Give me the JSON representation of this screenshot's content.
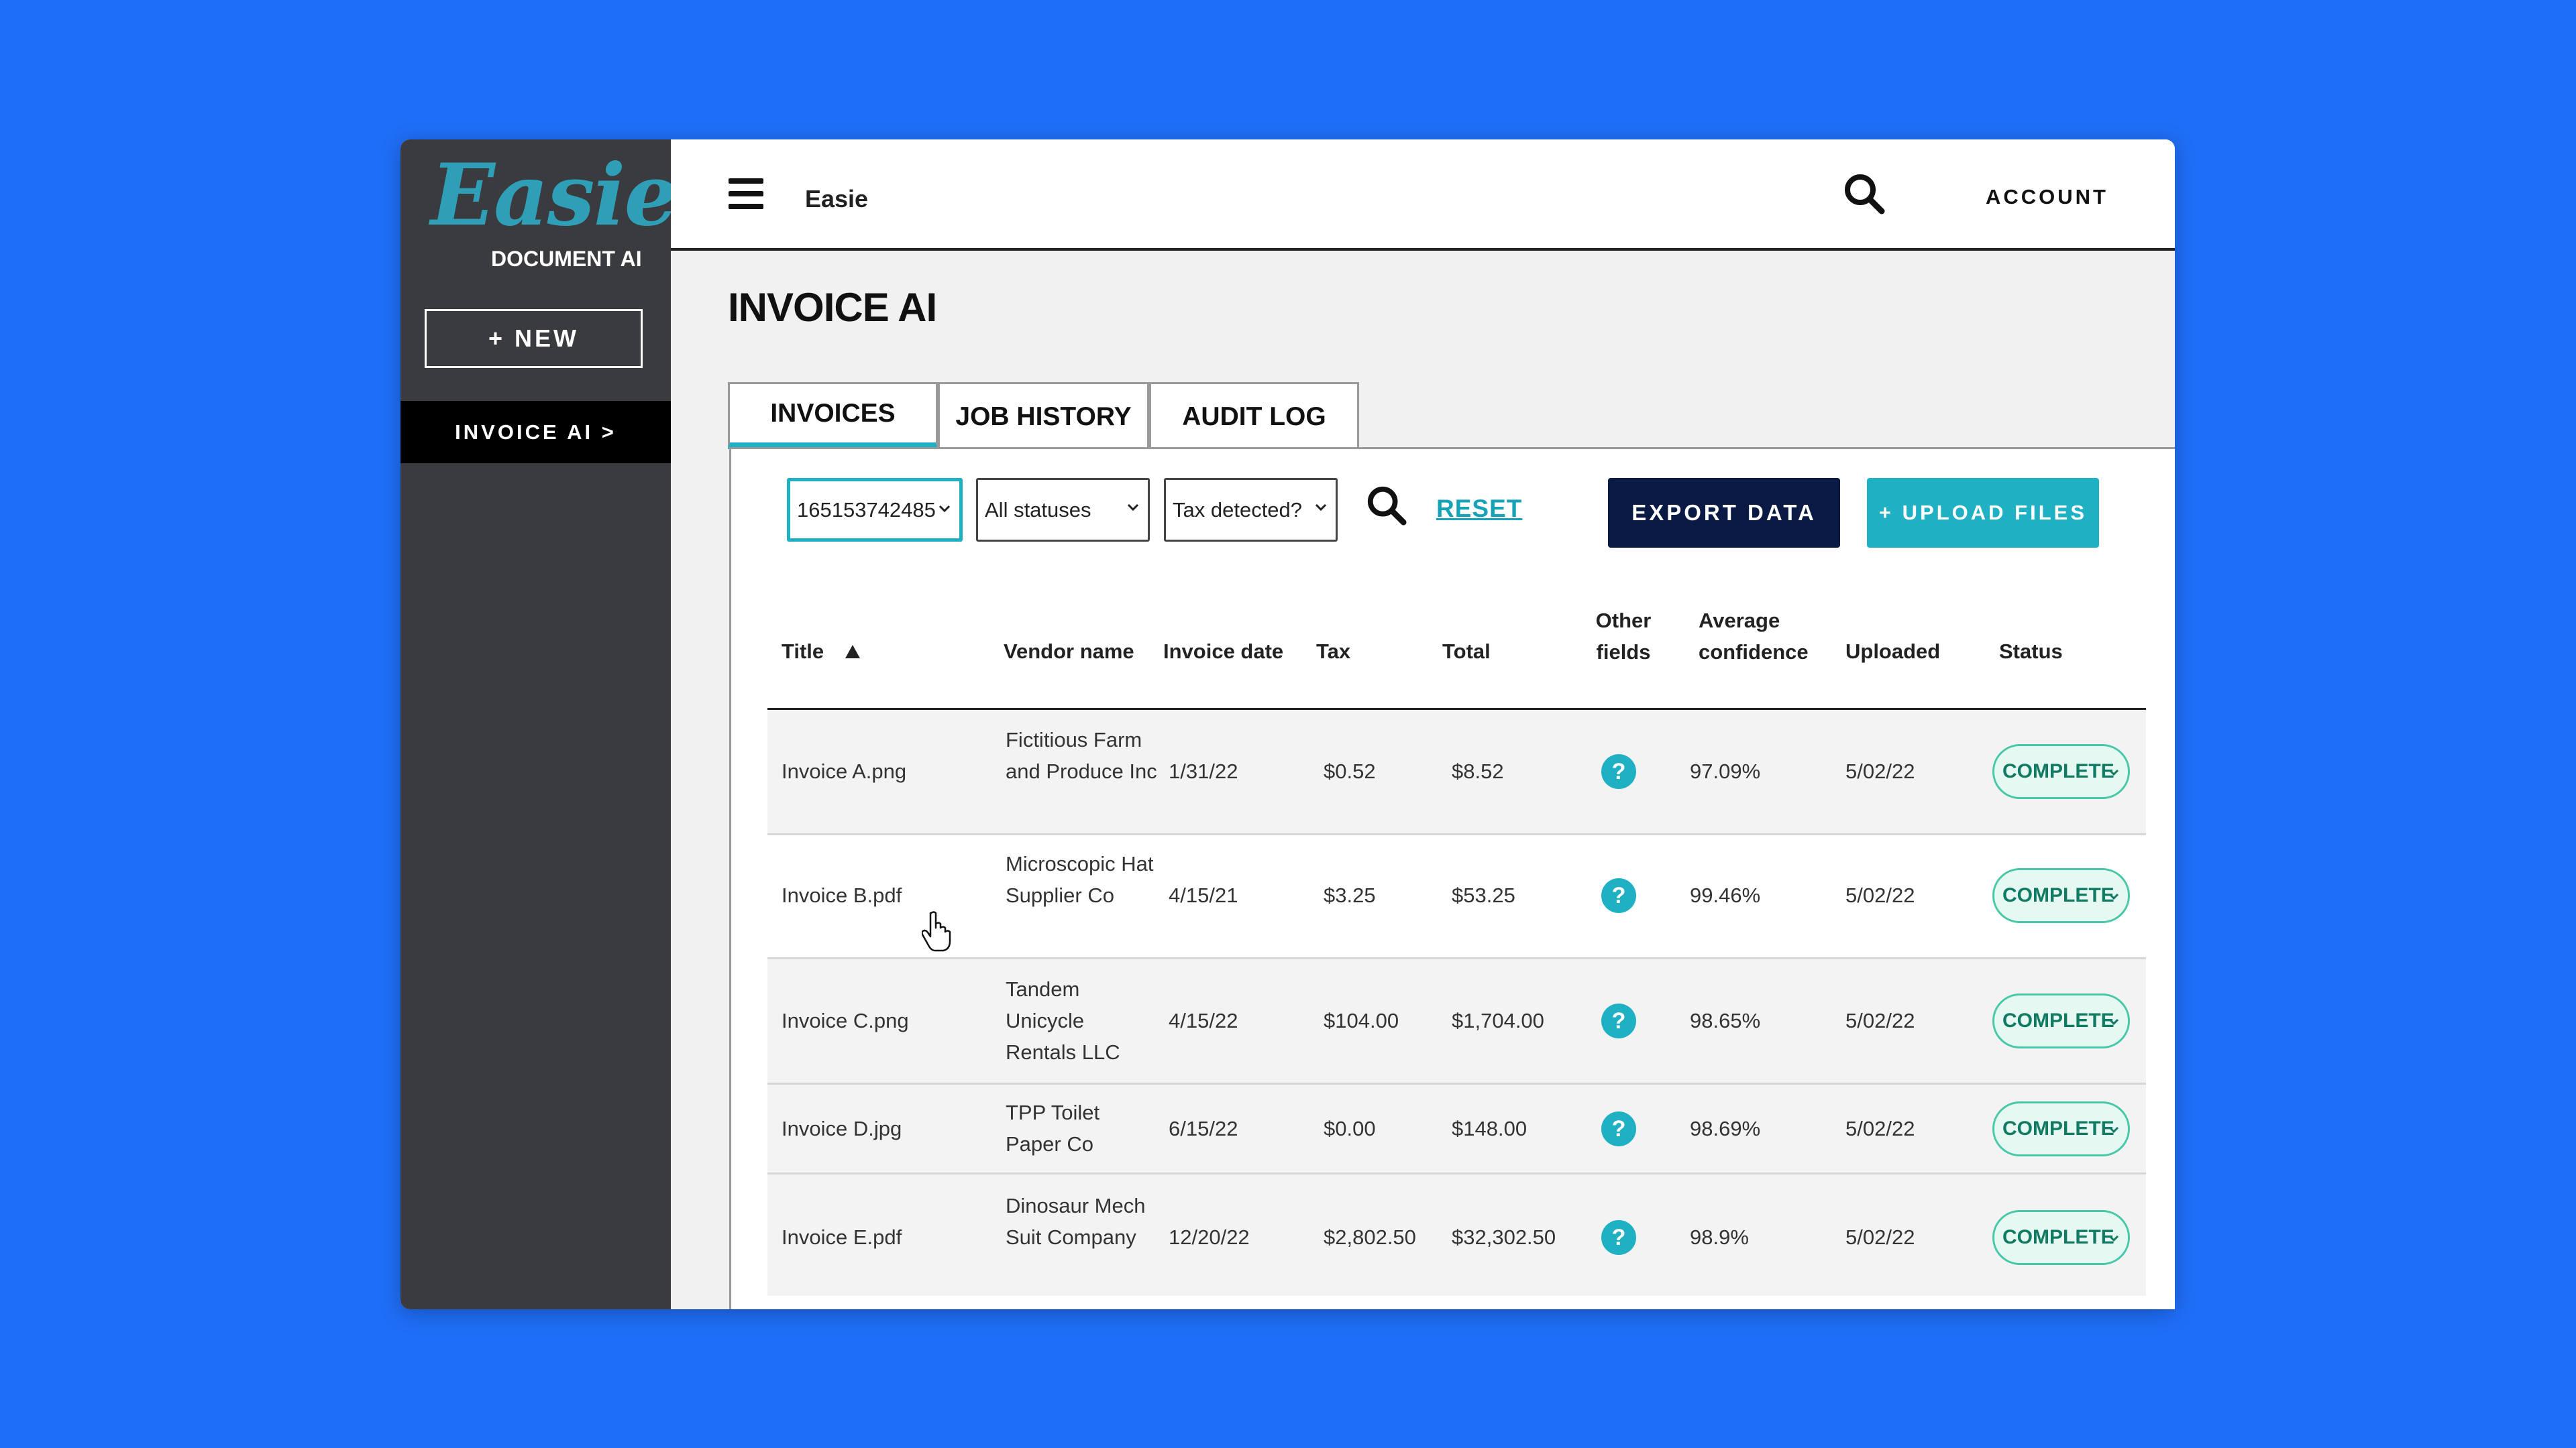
{
  "sidebar": {
    "logo": "Easie",
    "logo_sub": "DOCUMENT AI",
    "new_button": "+ NEW",
    "nav_active": "INVOICE AI >"
  },
  "topbar": {
    "app_name": "Easie",
    "account": "ACCOUNT",
    "icons": [
      "hamburger-icon",
      "search-icon"
    ]
  },
  "page": {
    "title": "INVOICE AI"
  },
  "tabs": [
    {
      "label": "INVOICES",
      "active": true
    },
    {
      "label": "JOB HISTORY",
      "active": false
    },
    {
      "label": "AUDIT LOG",
      "active": false
    }
  ],
  "filters": {
    "job_select": "165153742485",
    "status_select": "All statuses",
    "tax_select": "Tax detected?",
    "reset": "RESET",
    "export": "EXPORT DATA",
    "upload": "+ UPLOAD FILES"
  },
  "table": {
    "headers": {
      "title": "Title",
      "vendor": "Vendor name",
      "date": "Invoice date",
      "tax": "Tax",
      "total": "Total",
      "other_fields": "Other fields",
      "avg_conf": "Average confidence",
      "uploaded": "Uploaded",
      "status": "Status"
    },
    "rows": [
      {
        "title": "Invoice A.png",
        "vendor": "Fictitious Farm and Produce Inc",
        "date": "1/31/22",
        "tax": "$0.52",
        "total": "$8.52",
        "conf": "97.09%",
        "uploaded": "5/02/22",
        "status": "COMPLETE"
      },
      {
        "title": "Invoice B.pdf",
        "vendor": "Microscopic Hat Supplier Co",
        "date": "4/15/21",
        "tax": "$3.25",
        "total": "$53.25",
        "conf": "99.46%",
        "uploaded": "5/02/22",
        "status": "COMPLETE"
      },
      {
        "title": "Invoice C.png",
        "vendor": "Tandem Unicycle Rentals LLC",
        "date": "4/15/22",
        "tax": "$104.00",
        "total": "$1,704.00",
        "conf": "98.65%",
        "uploaded": "5/02/22",
        "status": "COMPLETE"
      },
      {
        "title": "Invoice D.jpg",
        "vendor": "TPP Toilet Paper Co",
        "date": "6/15/22",
        "tax": "$0.00",
        "total": "$148.00",
        "conf": "98.69%",
        "uploaded": "5/02/22",
        "status": "COMPLETE"
      },
      {
        "title": "Invoice E.pdf",
        "vendor": "Dinosaur Mech Suit Company",
        "date": "12/20/22",
        "tax": "$2,802.50",
        "total": "$32,302.50",
        "conf": "98.9%",
        "uploaded": "5/02/22",
        "status": "COMPLETE"
      }
    ]
  },
  "colors": {
    "background": "#1f6ef7",
    "sidebar": "#3a3b3f",
    "accent": "#1fb0c4",
    "navy": "#0b1a45",
    "status_green": "#48c8a8"
  }
}
